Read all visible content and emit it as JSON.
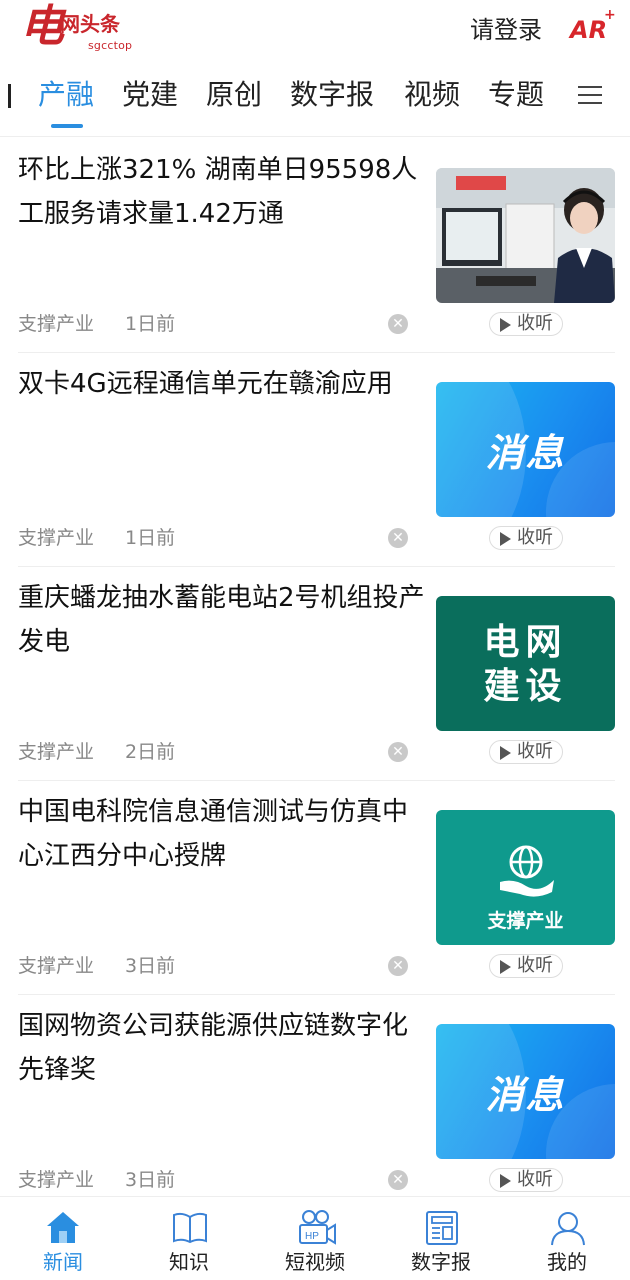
{
  "header": {
    "logo_main": "电",
    "logo_text": "网头条",
    "logo_sub": "sgcctop",
    "login_label": "请登录",
    "ar_label": "AR",
    "ar_plus": "+"
  },
  "tabs": [
    {
      "label": "产融",
      "active": true
    },
    {
      "label": "党建",
      "active": false
    },
    {
      "label": "原创",
      "active": false
    },
    {
      "label": "数字报",
      "active": false
    },
    {
      "label": "视频",
      "active": false
    },
    {
      "label": "专题",
      "active": false
    }
  ],
  "news": [
    {
      "title": "环比上涨321% 湖南单日95598人工服务请求量1.42万通",
      "source": "支撑产业",
      "time": "1日前",
      "thumb": "photo",
      "listen": "收听"
    },
    {
      "title": "双卡4G远程通信单元在赣渝应用",
      "source": "支撑产业",
      "time": "1日前",
      "thumb": "消息",
      "listen": "收听"
    },
    {
      "title": "重庆蟠龙抽水蓄能电站2号机组投产发电",
      "source": "支撑产业",
      "time": "2日前",
      "thumb_line1": "电网",
      "thumb_line2": "建设",
      "listen": "收听"
    },
    {
      "title": "中国电科院信息通信测试与仿真中心江西分中心授牌",
      "source": "支撑产业",
      "time": "3日前",
      "thumb": "支撑产业",
      "listen": "收听"
    },
    {
      "title": "国网物资公司获能源供应链数字化先锋奖",
      "source": "支撑产业",
      "time": "3日前",
      "thumb": "消息",
      "listen": "收听"
    }
  ],
  "dismiss_glyph": "✕",
  "bottom_nav": [
    {
      "label": "新闻",
      "icon": "home-icon",
      "active": true
    },
    {
      "label": "知识",
      "icon": "book-icon",
      "active": false
    },
    {
      "label": "短视频",
      "icon": "video-camera-icon",
      "active": false
    },
    {
      "label": "数字报",
      "icon": "newspaper-icon",
      "active": false
    },
    {
      "label": "我的",
      "icon": "user-icon",
      "active": false
    }
  ],
  "colors": {
    "accent": "#2a8ee0",
    "brand_red": "#c9262c",
    "muted_text": "#888888"
  }
}
